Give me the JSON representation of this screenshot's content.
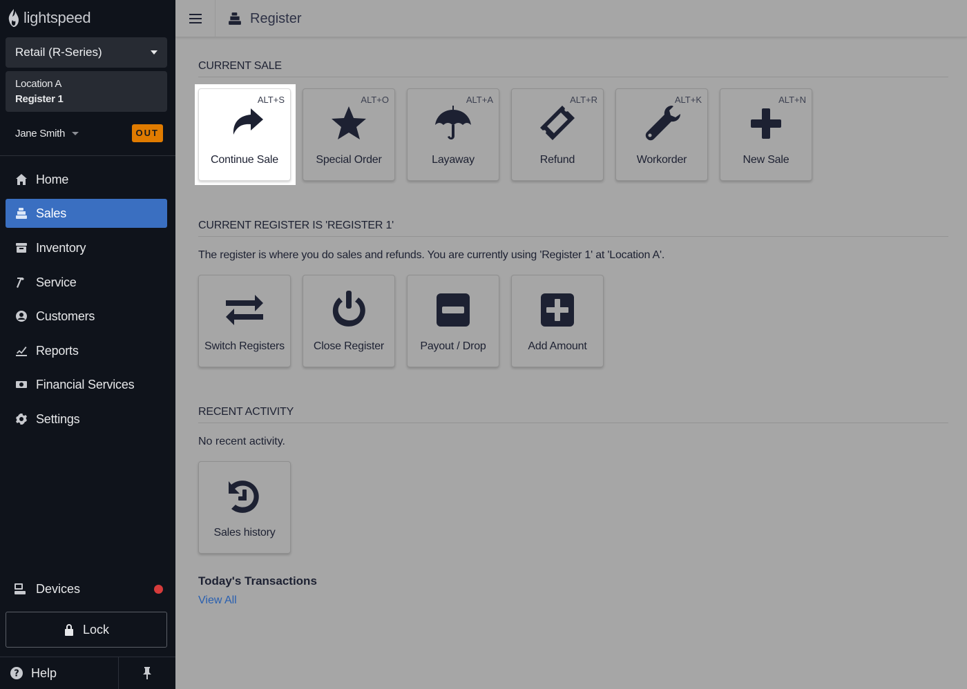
{
  "brand": {
    "name": "lightspeed"
  },
  "sidebar": {
    "store_select": "Retail (R-Series)",
    "location": "Location A",
    "register": "Register 1",
    "user": "Jane Smith",
    "status_badge": "OUT",
    "items": [
      {
        "label": "Home",
        "icon": "home-icon"
      },
      {
        "label": "Sales",
        "icon": "register-icon",
        "active": true
      },
      {
        "label": "Inventory",
        "icon": "inventory-icon"
      },
      {
        "label": "Service",
        "icon": "hammer-icon"
      },
      {
        "label": "Customers",
        "icon": "user-icon"
      },
      {
        "label": "Reports",
        "icon": "chart-icon"
      },
      {
        "label": "Financial Services",
        "icon": "money-icon"
      },
      {
        "label": "Settings",
        "icon": "gear-icon"
      }
    ],
    "devices": "Devices",
    "lock": "Lock",
    "help": "Help"
  },
  "header": {
    "title": "Register"
  },
  "current_sale": {
    "heading": "CURRENT SALE",
    "tiles": [
      {
        "label": "Continue Sale",
        "shortcut": "ALT+S",
        "icon": "share-arrow-icon"
      },
      {
        "label": "Special Order",
        "shortcut": "ALT+O",
        "icon": "star-icon"
      },
      {
        "label": "Layaway",
        "shortcut": "ALT+A",
        "icon": "umbrella-icon"
      },
      {
        "label": "Refund",
        "shortcut": "ALT+R",
        "icon": "ticket-icon"
      },
      {
        "label": "Workorder",
        "shortcut": "ALT+K",
        "icon": "wrench-icon"
      },
      {
        "label": "New Sale",
        "shortcut": "ALT+N",
        "icon": "plus-icon"
      }
    ]
  },
  "register_section": {
    "heading": "CURRENT REGISTER IS 'REGISTER 1'",
    "description": "The register is where you do sales and refunds. You are currently using 'Register 1'  at 'Location A'.",
    "tiles": [
      {
        "label": "Switch Registers",
        "icon": "exchange-icon"
      },
      {
        "label": "Close Register",
        "icon": "power-icon"
      },
      {
        "label": "Payout / Drop",
        "icon": "minus-square-icon"
      },
      {
        "label": "Add Amount",
        "icon": "plus-square-icon"
      }
    ]
  },
  "recent": {
    "heading": "RECENT ACTIVITY",
    "empty": "No recent activity.",
    "tiles": [
      {
        "label": "Sales history",
        "icon": "history-icon"
      }
    ]
  },
  "transactions": {
    "heading": "Today's Transactions",
    "view_all": "View All"
  },
  "colors": {
    "sidebar_bg": "#0f131b",
    "active_nav": "#3a6fc1",
    "badge": "#e07b00",
    "link": "#285fb0",
    "alert_dot": "#d63b3b"
  }
}
